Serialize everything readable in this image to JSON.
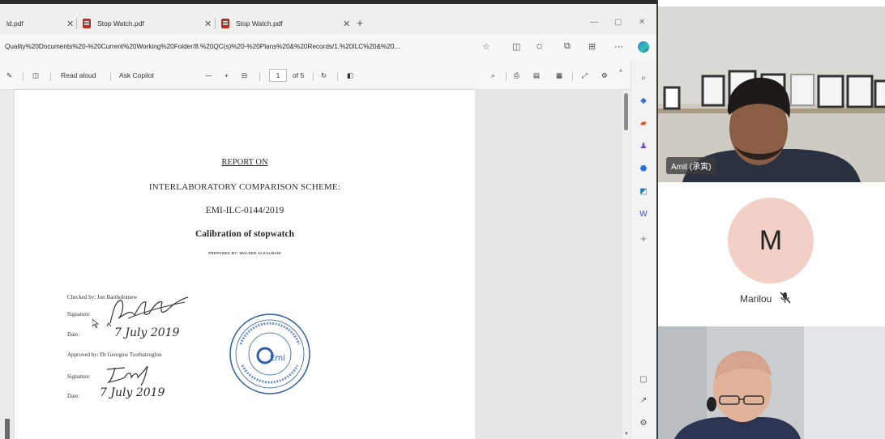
{
  "browser": {
    "tabs": [
      {
        "label": "ld.pdf"
      },
      {
        "label": "Stop Watch.pdf"
      },
      {
        "label": "Stop Watch.pdf"
      }
    ],
    "url": "Quality%20Documents%20-%20Current%20Working%20Folder/8.%20QC(s)%20-%20Plans%20&%20Records/1.%20ILC%20&%20...",
    "toolbar": {
      "read_aloud": "Read aloud",
      "ask_copilot": "Ask Copilot",
      "zoom_out": "—",
      "zoom_in": "+",
      "page_current": "1",
      "page_total": "of 5"
    }
  },
  "document": {
    "title": "REPORT ON",
    "scheme": "INTERLABORATORY COMPARISON SCHEME:",
    "code": "EMI-ILC-0144/2019",
    "subject": "Calibration of stopwatch",
    "prepared_by": "PREPARED BY: WALEED ALKALBANI",
    "checked_by": "Checked by: Jon Bartholomew",
    "signature_label_1": "Signature:",
    "date_label_1": "Date:",
    "date_value_1": "7 July 2019",
    "approved_by": "Approved by: Dr Georgios Tsorbatzoglou",
    "signature_label_2": "Signature:",
    "date_label_2": "Date:",
    "date_value_2": "7 July 2019",
    "stamp_text": "Emi",
    "stamp_colors": {
      "ink": "#2f5fa8"
    }
  },
  "participants": [
    {
      "name": "Amit (承寅)",
      "type": "video"
    },
    {
      "name": "Marilou",
      "initial": "M",
      "muted": true,
      "avatar_color": "#f2cfc7"
    },
    {
      "name": "",
      "type": "video"
    }
  ],
  "colors": {
    "pdf_red": "#c42b1c",
    "edge_blue": "#2d7fe0"
  }
}
